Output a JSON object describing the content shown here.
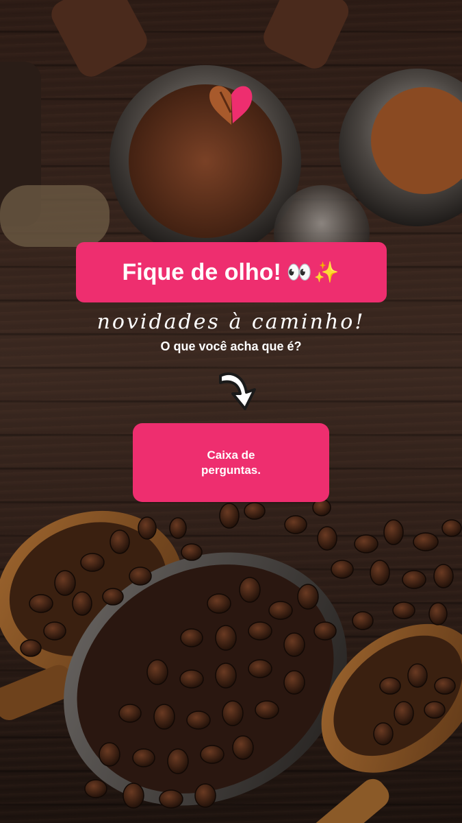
{
  "story": {
    "title": "Fique de olho!",
    "title_emoji": "👀✨",
    "script_line": "novidades à caminho!",
    "question": "O que você acha que é?",
    "question_box_label": "Caixa de perguntas.",
    "icons": [
      "coffee-heart-icon",
      "curved-arrow-icon"
    ],
    "colors": {
      "accent": "#ee2e6f",
      "text": "#ffffff"
    }
  }
}
